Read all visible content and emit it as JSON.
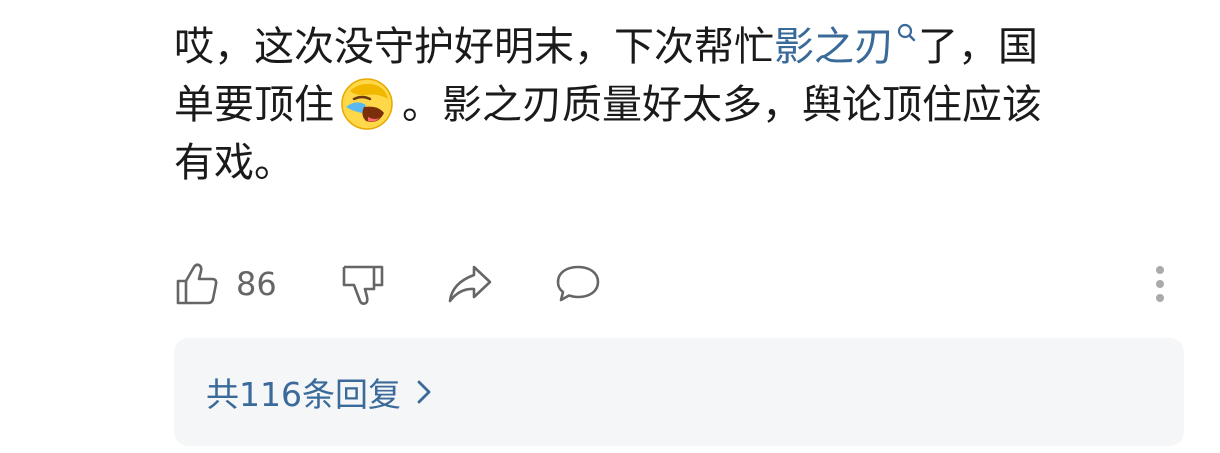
{
  "comment": {
    "line1_before": "哎，这次没守护好明末，下次帮忙",
    "link_text": "影之刃",
    "line1_after": "了，国",
    "line2_before": "单要顶住",
    "emoji_name": "laughing-with-tears-emoji",
    "line2_after": "。影之刃质量好太多，舆论顶住应该",
    "line3": "有戏。"
  },
  "actions": {
    "like_count": "86"
  },
  "replies": {
    "label": "共116条回复"
  },
  "colors": {
    "text": "#1a1a1a",
    "link": "#3a6a99",
    "icon": "#666666",
    "reply_bg": "#f5f6f8"
  }
}
